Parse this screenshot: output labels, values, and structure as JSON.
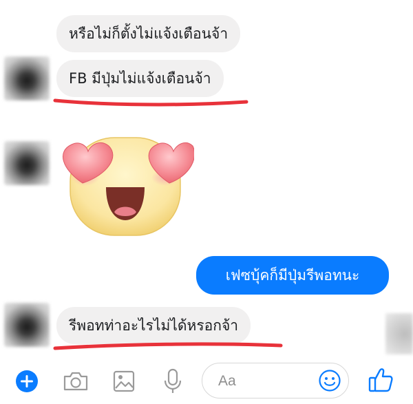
{
  "messages": [
    {
      "side": "in",
      "text": "หรือไม่ก็ตั้งไม่แจ้งเตือนจ้า"
    },
    {
      "side": "in",
      "text": "FB มีปุ่มไม่แจ้งเตือนจ้า"
    },
    {
      "side": "in",
      "type": "sticker",
      "sticker": "heart-eyes-face-sticker"
    },
    {
      "side": "out",
      "text": "เฟซบุ้คก็มีปุ่มรีพอทนะ"
    },
    {
      "side": "in",
      "text": "รีพอทท่าอะไรไม่ได้หรอกจ้า"
    }
  ],
  "composer": {
    "placeholder": "Aa",
    "icons": [
      "plus-icon",
      "camera-icon",
      "image-icon",
      "microphone-icon",
      "smiley-icon",
      "thumbs-up-icon"
    ]
  },
  "colors": {
    "accent": "#0a7cff",
    "incoming_bubble": "#f1f0f0",
    "annotation": "#e8323a"
  }
}
